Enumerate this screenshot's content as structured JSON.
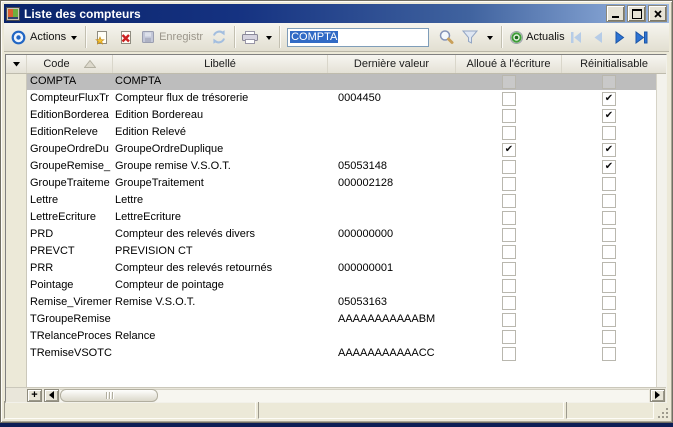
{
  "window": {
    "title": "Liste des compteurs"
  },
  "toolbar": {
    "actions_label": "Actions",
    "save_label": "Enregistr",
    "refresh_label": "Actualis",
    "filter_value": "COMPTA"
  },
  "grid": {
    "columns": [
      "Code",
      "Libellé",
      "Dernière valeur",
      "Alloué à l'écriture",
      "Réinitialisable"
    ],
    "sort_column": "Code",
    "sort_direction": "asc",
    "add_button_label": "+",
    "check_glyph": "✔",
    "rows": [
      {
        "code": "COMPTA",
        "libelle": "COMPTA",
        "valeur": "",
        "alloue": false,
        "reinit": false,
        "selected": true
      },
      {
        "code": "CompteurFluxTr",
        "libelle": "Compteur flux de trésorerie",
        "valeur": "0004450",
        "alloue": false,
        "reinit": true,
        "selected": false
      },
      {
        "code": "EditionBorderea",
        "libelle": "Edition Bordereau",
        "valeur": "",
        "alloue": false,
        "reinit": true,
        "selected": false
      },
      {
        "code": "EditionReleve",
        "libelle": "Edition Relevé",
        "valeur": "",
        "alloue": false,
        "reinit": false,
        "selected": false
      },
      {
        "code": "GroupeOrdreDu",
        "libelle": "GroupeOrdreDuplique",
        "valeur": "",
        "alloue": true,
        "reinit": true,
        "selected": false
      },
      {
        "code": "GroupeRemise_",
        "libelle": "Groupe remise V.S.O.T.",
        "valeur": "05053148",
        "alloue": false,
        "reinit": true,
        "selected": false
      },
      {
        "code": "GroupeTraiteme",
        "libelle": "GroupeTraitement",
        "valeur": "000002128",
        "alloue": false,
        "reinit": false,
        "selected": false
      },
      {
        "code": "Lettre",
        "libelle": "Lettre",
        "valeur": "",
        "alloue": false,
        "reinit": false,
        "selected": false
      },
      {
        "code": "LettreEcriture",
        "libelle": "LettreEcriture",
        "valeur": "",
        "alloue": false,
        "reinit": false,
        "selected": false
      },
      {
        "code": "PRD",
        "libelle": "Compteur des relevés divers",
        "valeur": "000000000",
        "alloue": false,
        "reinit": false,
        "selected": false
      },
      {
        "code": "PREVCT",
        "libelle": "PREVISION CT",
        "valeur": "",
        "alloue": false,
        "reinit": false,
        "selected": false
      },
      {
        "code": "PRR",
        "libelle": "Compteur des relevés retournés",
        "valeur": "000000001",
        "alloue": false,
        "reinit": false,
        "selected": false
      },
      {
        "code": "Pointage",
        "libelle": "Compteur de pointage",
        "valeur": "",
        "alloue": false,
        "reinit": false,
        "selected": false
      },
      {
        "code": "Remise_Viremer",
        "libelle": "Remise V.S.O.T.",
        "valeur": "05053163",
        "alloue": false,
        "reinit": false,
        "selected": false
      },
      {
        "code": "TGroupeRemise",
        "libelle": "",
        "valeur": "AAAAAAAAAAABM",
        "alloue": false,
        "reinit": false,
        "selected": false
      },
      {
        "code": "TRelanceProces",
        "libelle": "Relance",
        "valeur": "",
        "alloue": false,
        "reinit": false,
        "selected": false
      },
      {
        "code": "TRemiseVSOTC",
        "libelle": "",
        "valeur": "AAAAAAAAAAACC",
        "alloue": false,
        "reinit": false,
        "selected": false
      }
    ]
  },
  "icons": {
    "app": "window-colored-squares",
    "actions": "blue-target-circle",
    "new": "document-yellow-star",
    "delete": "document-red-x",
    "save": "floppy-disk",
    "refresh": "cycle-arrows",
    "print": "printer",
    "search": "magnifier",
    "filter": "funnel",
    "actualiser": "green-ring",
    "nav_first": "bar-left-triangle",
    "nav_prev": "left-triangle",
    "nav_next": "right-triangle",
    "nav_last": "right-triangle-bar",
    "sort_asc": "up-triangle",
    "gutter_dropdown": "down-triangle"
  },
  "colors": {
    "titlebar_start": "#0a246a",
    "titlebar_end": "#9cb9e4",
    "window_chrome": "#ece9d8",
    "row_selection": "#bdbdbd",
    "text_selection": "#316ac5",
    "nav_enabled": "#2d74d4",
    "nav_disabled": "#b6cce7",
    "refresh_green": "#3f9e3a"
  }
}
